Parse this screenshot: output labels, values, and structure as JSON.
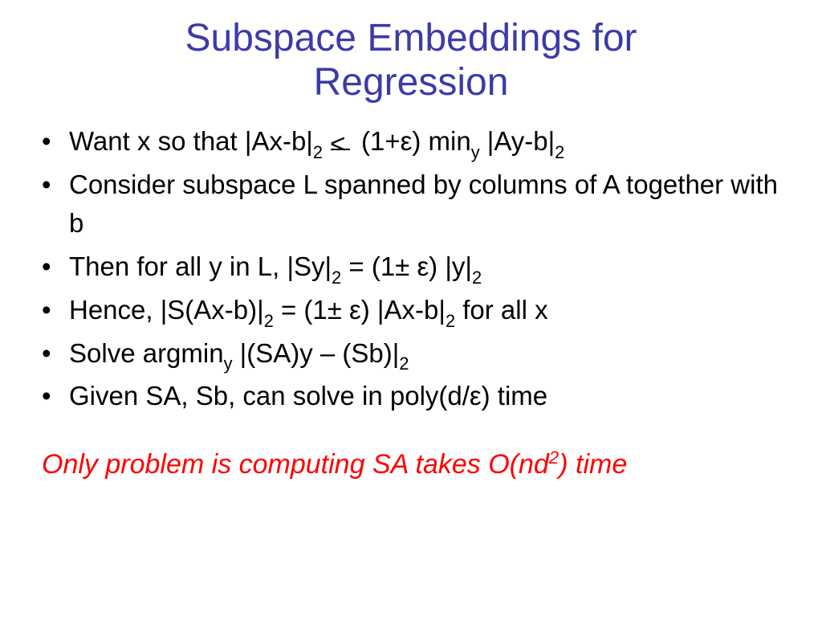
{
  "title_line1": "Subspace Embeddings for",
  "title_line2": "Regression",
  "bullets": {
    "b1_a": "Want x so that |Ax-b|",
    "b1_b": " (1+ε) min",
    "b1_c": " |Ay-b|",
    "b2": "Consider subspace L spanned by columns of A together with b",
    "b3_a": "Then for all y in L, |Sy|",
    "b3_b": " = (1± ε) |y|",
    "b4_a": "Hence, |S(Ax-b)|",
    "b4_b": " = (1± ε) |Ax-b|",
    "b4_c": " for all x",
    "b5_a": "Solve argmin",
    "b5_b": " |(SA)y – (Sb)|",
    "b6": "Given SA, Sb, can solve in poly(d/ε) time"
  },
  "subs": {
    "two": "2",
    "y": "y"
  },
  "footer_a": "Only problem is computing SA takes O(nd",
  "footer_b": ") time",
  "footer_sup": "2"
}
